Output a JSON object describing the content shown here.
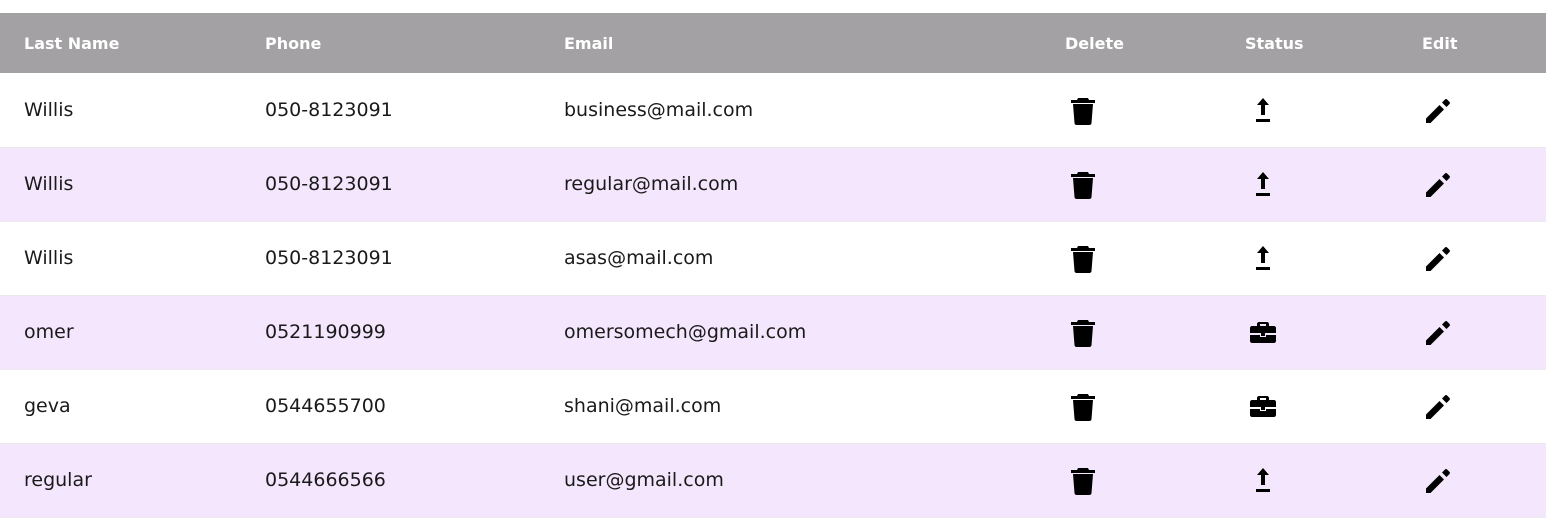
{
  "table": {
    "headers": {
      "last_name": "Last Name",
      "phone": "Phone",
      "email": "Email",
      "delete": "Delete",
      "status": "Status",
      "edit": "Edit"
    },
    "rows": [
      {
        "last_name": "Willis",
        "phone": "050-8123091",
        "email": "business@mail.com",
        "status_icon": "upload-icon"
      },
      {
        "last_name": "Willis",
        "phone": "050-8123091",
        "email": "regular@mail.com",
        "status_icon": "upload-icon"
      },
      {
        "last_name": "Willis",
        "phone": "050-8123091",
        "email": "asas@mail.com",
        "status_icon": "upload-icon"
      },
      {
        "last_name": "omer",
        "phone": "0521190999",
        "email": "omersomech@gmail.com",
        "status_icon": "briefcase-icon"
      },
      {
        "last_name": "geva",
        "phone": "0544655700",
        "email": "shani@mail.com",
        "status_icon": "briefcase-icon"
      },
      {
        "last_name": "regular",
        "phone": "0544666566",
        "email": "user@gmail.com",
        "status_icon": "upload-icon"
      }
    ]
  },
  "colors": {
    "header_bg": "#a3a1a3",
    "row_alt_bg": "#f3e6fd",
    "row_bg": "#ffffff"
  }
}
